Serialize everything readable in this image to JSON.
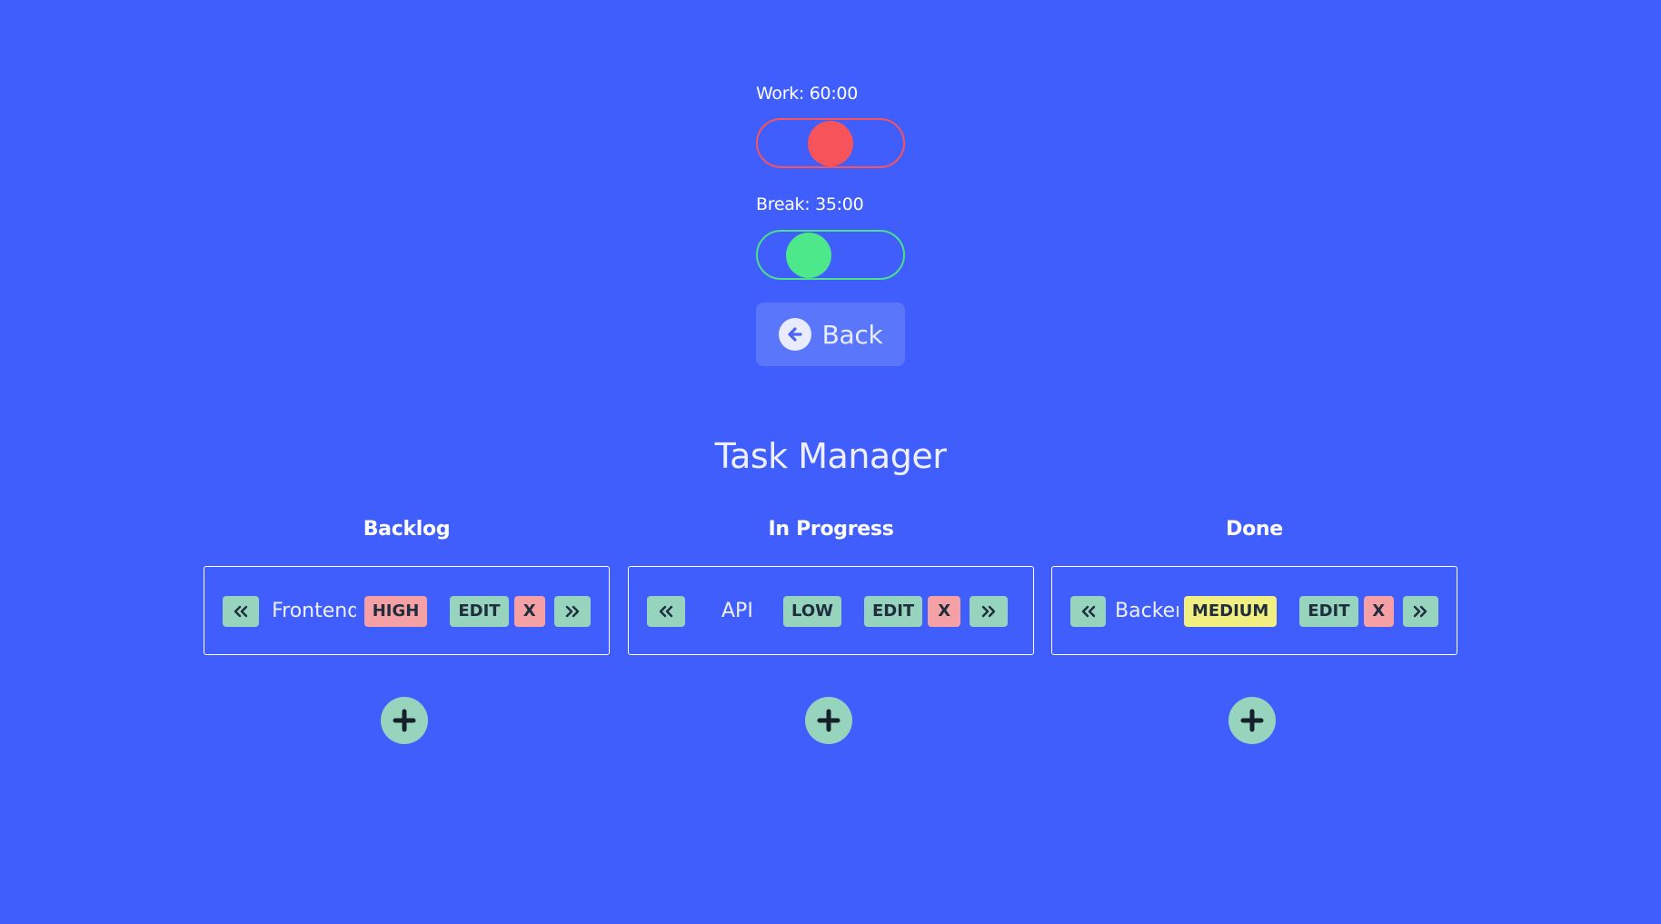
{
  "timers": {
    "work_label": "Work: 60:00",
    "work_slider_value": 0.5,
    "break_label": "Break: 35:00",
    "break_slider_value": 0.35
  },
  "back_button": {
    "label": "Back",
    "icon": "arrow-left-circle-icon"
  },
  "page_title": "Task Manager",
  "columns": [
    {
      "title": "Backlog",
      "task": {
        "name": "Frontend",
        "priority": "HIGH",
        "edit_label": "EDIT",
        "delete_label": "X"
      }
    },
    {
      "title": "In Progress",
      "task": {
        "name": "API",
        "priority": "LOW",
        "edit_label": "EDIT",
        "delete_label": "X"
      }
    },
    {
      "title": "Done",
      "task": {
        "name": "Backer",
        "priority": "MEDIUM",
        "edit_label": "EDIT",
        "delete_label": "X"
      }
    }
  ],
  "colors": {
    "background": "#3f5efb",
    "work_accent": "#f7535a",
    "break_accent": "#4ce08a",
    "button_green": "#96d4be",
    "priority_high": "#f5a0a4",
    "priority_low": "#96d4be",
    "priority_medium": "#f1ef82"
  }
}
